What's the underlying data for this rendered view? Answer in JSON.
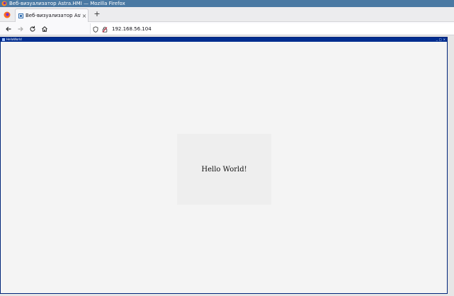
{
  "os_window": {
    "title": "Веб-визуализатор Astra.HMI — Mozilla Firefox",
    "title_bar_color": "#4a79a3"
  },
  "tabs": [
    {
      "title": "Веб-визуализатор Astra.HMI",
      "close_glyph": "×"
    }
  ],
  "tab_strip": {
    "new_tab_glyph": "+"
  },
  "nav": {
    "url": "192.168.56.104"
  },
  "hmi": {
    "window_title": "HelloWorld",
    "title_color": "#002d8f",
    "controls": [
      "_",
      "□",
      "×"
    ],
    "panel_text": "Hello World!"
  },
  "icons": {
    "firefox_menu": "firefox-icon",
    "back": "arrow-left-icon",
    "forward": "arrow-right-icon",
    "reload": "reload-icon",
    "home": "home-icon",
    "shield": "shield-icon",
    "lock": "lock-icon"
  }
}
